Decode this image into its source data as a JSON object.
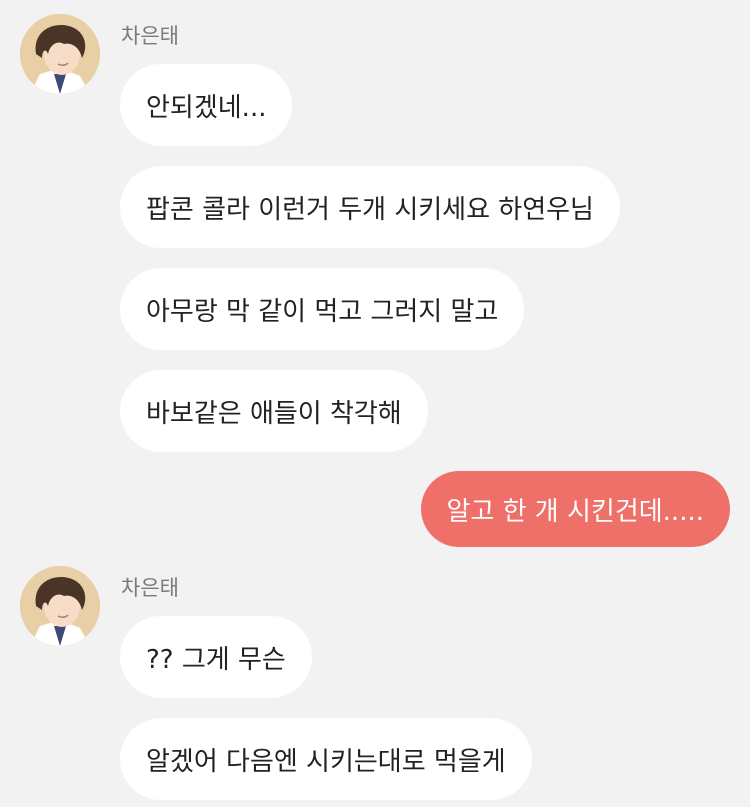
{
  "colors": {
    "background": "#f2f2f2",
    "incoming_bubble": "#ffffff",
    "outgoing_bubble": "#ee7069",
    "sender_name": "#7a7a7a",
    "text": "#222222"
  },
  "groups": [
    {
      "sender": "차은태",
      "avatar_icon": "profile-avatar-icon",
      "messages": [
        "안되겠네...",
        "팝콘 콜라 이런거 두개 시키세요 하연우님",
        "아무랑 막 같이 먹고 그러지 말고",
        "바보같은 애들이 착각해"
      ]
    },
    {
      "outgoing": true,
      "messages": [
        "알고 한 개 시킨건데....."
      ]
    },
    {
      "sender": "차은태",
      "avatar_icon": "profile-avatar-icon",
      "messages": [
        "?? 그게 무슨",
        "알겠어 다음엔 시키는대로 먹을게"
      ]
    }
  ]
}
